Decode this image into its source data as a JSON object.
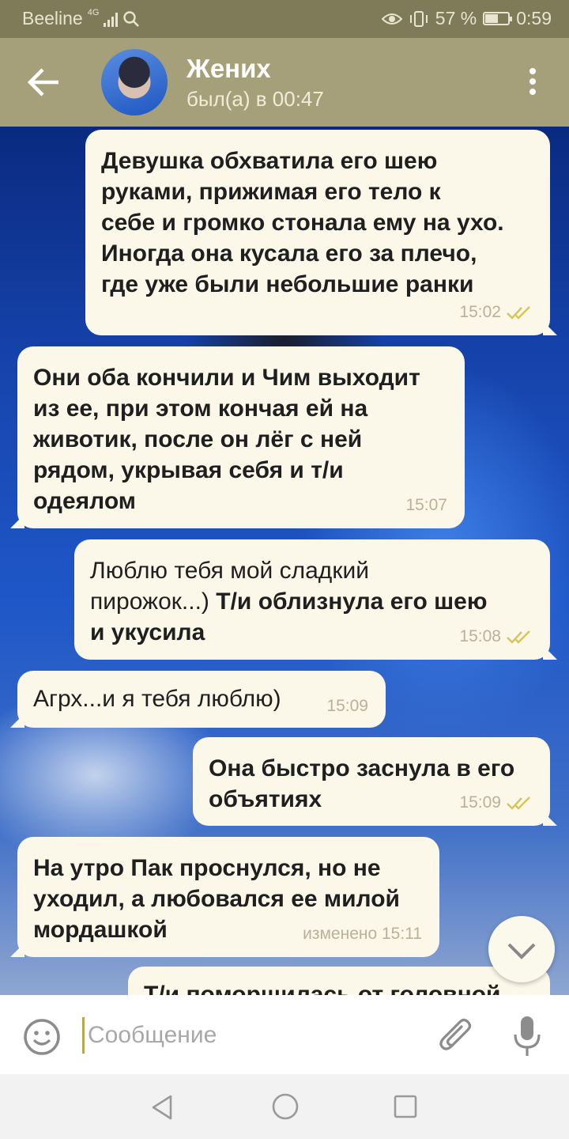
{
  "status_bar": {
    "carrier": "Beeline",
    "network": "4G",
    "battery": "57 %",
    "battery_level": 0.57,
    "time": "0:59"
  },
  "header": {
    "back_icon": "arrow-left-icon",
    "title": "Жених",
    "subtitle": "был(а) в 00:47",
    "menu_icon": "more-vertical-icon"
  },
  "messages": [
    {
      "dir": "out",
      "lines": [
        "Девушка обхватила его шею",
        "руками, прижимая его тело к",
        "себе и громко стонала ему на ухо.",
        "Иногда она кусала его за плечо,",
        "где уже были небольшие ранки"
      ],
      "time": "15:02",
      "read": true
    },
    {
      "dir": "in",
      "lines": [
        "Они оба кончили и Чим выходит",
        "из ее, при этом кончая ей на",
        "животик, после он лёг с ней",
        "рядом, укрывая себя и т/и",
        "одеялом"
      ],
      "time": "15:07"
    },
    {
      "dir": "out",
      "line1_light": "Люблю тебя мой сладкий",
      "line2_light": "пирожок...) ",
      "line2_bold": "Т/и облизнула его шею",
      "line3_bold": "и укусила",
      "time": "15:08",
      "read": true
    },
    {
      "dir": "in",
      "text": "Агрх...и я тебя люблю)",
      "time": "15:09"
    },
    {
      "dir": "out",
      "lines": [
        "Она быстро заснула в его",
        "объятиях"
      ],
      "time": "15:09",
      "read": true
    },
    {
      "dir": "in",
      "lines": [
        "На утро Пак проснулся, но не",
        "уходил, а любовался ее милой",
        "мордашкой"
      ],
      "time": "изменено 15:11"
    },
    {
      "dir": "out",
      "partial": "Т/и поморщилась от головной"
    }
  ],
  "input": {
    "placeholder": "Сообщение",
    "emoji_icon": "emoji-icon",
    "attach_icon": "paperclip-icon",
    "mic_icon": "microphone-icon"
  },
  "scroll_down_icon": "chevron-down-icon",
  "nav": {
    "back_icon": "nav-back-triangle-icon",
    "home_icon": "nav-home-circle-icon",
    "recents_icon": "nav-recents-square-icon"
  },
  "colors": {
    "header": "#a6a07a",
    "status_bar": "#7f7a57",
    "bubble": "#fbf7e9",
    "tick": "#d6c55a"
  }
}
